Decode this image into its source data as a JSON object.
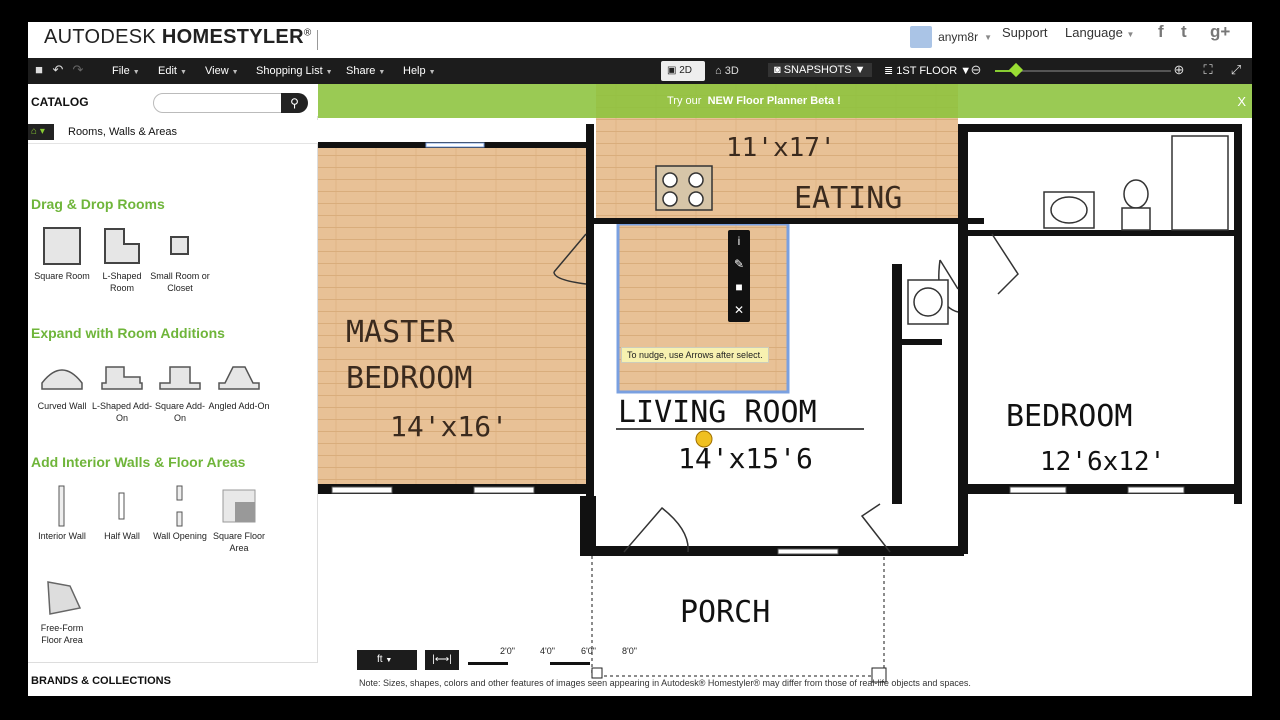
{
  "brand": {
    "logo_prefix": "AUTODESK",
    "logo_name": "HOMESTYLER",
    "logo_mark": "®"
  },
  "header": {
    "username": "anym8r",
    "support": "Support",
    "language": "Language"
  },
  "social": [
    "f",
    "t",
    "g+"
  ],
  "menubar": {
    "menus": [
      "File",
      "Edit",
      "View",
      "Shopping List",
      "Share",
      "Help"
    ],
    "btn_2d": "2D",
    "btn_3d": "3D",
    "snapshots": "SNAPSHOTS",
    "floor": "1ST FLOOR",
    "zoom_level": 0.12
  },
  "catalog": {
    "title": "CATALOG",
    "search_placeholder": "",
    "breadcrumb": "Rooms, Walls & Areas",
    "sections": [
      {
        "title": "Drag & Drop Rooms",
        "items": [
          "Square Room",
          "L-Shaped Room",
          "Small Room or Closet"
        ]
      },
      {
        "title": "Expand with Room Additions",
        "items": [
          "Curved Wall",
          "L-Shaped Add-On",
          "Square Add-On",
          "Angled Add-On"
        ]
      },
      {
        "title": "Add Interior Walls & Floor Areas",
        "items": [
          "Interior Wall",
          "Half Wall",
          "Wall Opening",
          "Square Floor Area"
        ]
      },
      {
        "title": "",
        "items": [
          "Free-Form Floor Area"
        ]
      }
    ],
    "brands": "BRANDS & COLLECTIONS"
  },
  "promo": {
    "prefix": "Try our",
    "highlight": "NEW Floor Planner Beta",
    "suffix": "!",
    "close": "X"
  },
  "plan": {
    "rooms": [
      {
        "name": "MASTER",
        "name2": "BEDROOM",
        "size": "14'x16'"
      },
      {
        "name": "EATING",
        "size": "11'x17'"
      },
      {
        "name": "LIVING ROOM",
        "size": "14'x15'6"
      },
      {
        "name": "BEDROOM",
        "size": "12'6x12'"
      },
      {
        "name": "PORCH"
      }
    ],
    "tooltip": "To nudge, use Arrows after select.",
    "tool_icons": [
      "info-icon",
      "paint-icon",
      "lock-icon",
      "close-icon"
    ]
  },
  "footer": {
    "unit": "ft",
    "scale_labels": [
      "2'0\"",
      "4'0\"",
      "6'0\"",
      "8'0\""
    ],
    "note": "Note: Sizes, shapes, colors and other features of images seen appearing in Autodesk® Homestyler® may differ from those of real-life objects and spaces."
  },
  "colors": {
    "accent": "#6fb53a",
    "menubar": "#1c1c1c",
    "floor_wood": "#e8c196",
    "wall": "#111111",
    "selection": "#7aa0e0"
  }
}
